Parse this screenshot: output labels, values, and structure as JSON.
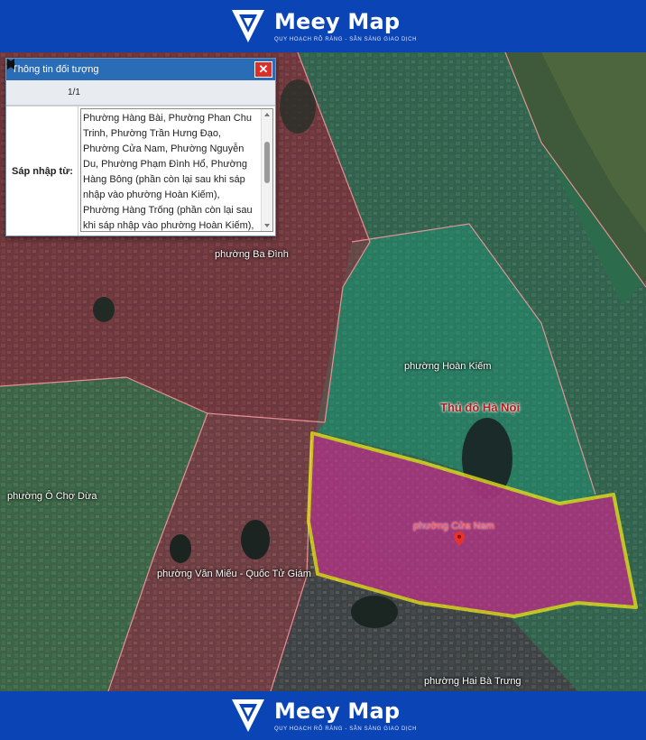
{
  "brand": {
    "name": "Meey Map",
    "tagline": "QUY HOẠCH RÕ RÀNG - SẴN SÀNG GIAO DỊCH",
    "color": "#0b44b4"
  },
  "panel": {
    "title": "Thông tin đối tượng",
    "close_icon": "close-icon",
    "page_indicator": "1/1",
    "field_label": "Sáp nhập từ:",
    "field_value": "Phường Hàng Bài, Phường Phan Chu Trinh, Phường Trần Hưng Đạo, Phường Cửa Nam, Phường Nguyễn Du, Phường Phạm Đình Hổ, Phường Hàng Bông (phần còn lại sau khi sáp nhập vào phường Hoàn Kiếm), Phường Hàng Trống (phần còn lại sau khi sáp nhập vào phường Hoàn Kiếm), Phường"
  },
  "map": {
    "labels": {
      "ba_dinh": "phường Ba Đình",
      "hoan_kiem": "phường Hoàn Kiếm",
      "capital": "Thủ đô Hà Nội",
      "o_cho_dua": "phường Ô Chợ Dừa",
      "cua_nam": "phường Cửa Nam",
      "van_mieu": "phường Văn Miếu - Quốc Tử Giám",
      "hai_ba_trung": "phường Hai Bà Trưng"
    },
    "highlight_color": "#f5ee1a",
    "selected_fill": "#c0338f",
    "marker_icon": "map-pin-icon"
  }
}
